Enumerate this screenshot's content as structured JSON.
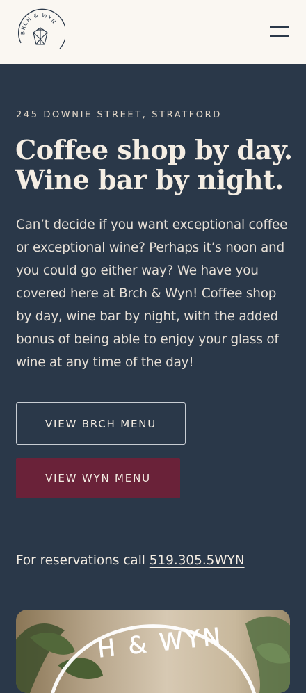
{
  "header": {
    "logo_text": "BRCH & WYN",
    "menu_icon": "hamburger-icon"
  },
  "hero": {
    "address": "245 DOWNIE STREET, STRATFORD",
    "headline_line1": "Coffee shop by day.",
    "headline_line2": "Wine bar by night.",
    "intro": "Can’t decide if you want exceptional coffee or exceptional wine? Perhaps it’s noon and you could go either way? We have you covered here at Brch & Wyn! Coffee shop by day, wine bar by night, with the added bonus of being able to enjoy your glass of wine at any time of the day!"
  },
  "buttons": {
    "brch_menu": "VIEW BRCH MENU",
    "wyn_menu": "VIEW WYN MENU"
  },
  "reservations": {
    "text": "For reservations call ",
    "phone": "519.305.5WYN"
  },
  "photo": {
    "sign_text": "H & WYN"
  },
  "colors": {
    "header_bg": "#faf7f2",
    "main_bg": "#2a3849",
    "wyn_button": "#6a2239",
    "text_light": "#f4ede3"
  }
}
